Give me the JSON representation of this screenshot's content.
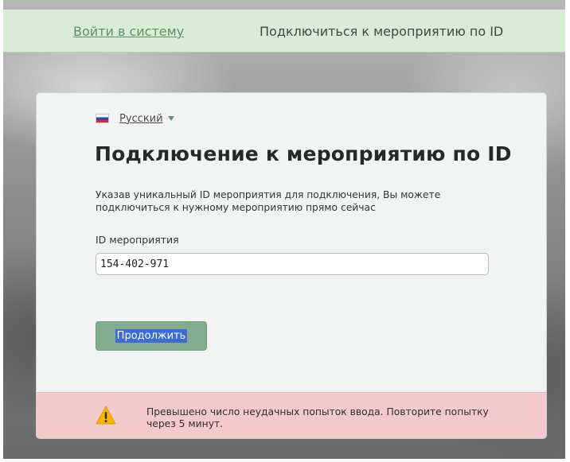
{
  "nav": {
    "login": "Войти в систему",
    "connect_by_id": "Подключиться к мероприятию по ID"
  },
  "language": {
    "label": "Русский",
    "flag_icon": "russia-flag-icon"
  },
  "page": {
    "title": "Подключение к мероприятию по ID",
    "description": "Указав уникальный ID мероприятия для подключения, Вы можете подключиться к нужному мероприятию прямо сейчас"
  },
  "form": {
    "id_label": "ID мероприятия",
    "id_value": "154-402-971",
    "continue_label": "Продолжить"
  },
  "alert": {
    "icon": "warning-icon",
    "text": "Превышено число неудачных попыток ввода. Повторите попытку через 5 минут."
  },
  "colors": {
    "topbar_bg": "#d9ecd6",
    "accent_green": "#83ac8e",
    "alert_bg": "#f4c9c9",
    "warning_yellow": "#f2b705"
  }
}
